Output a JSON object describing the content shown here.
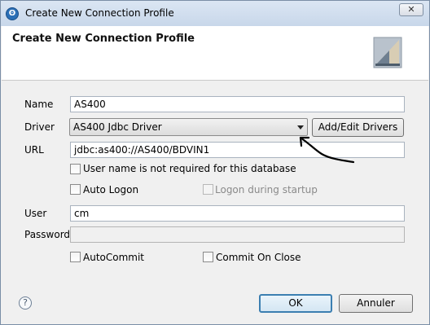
{
  "window": {
    "title": "Create New Connection Profile",
    "close_glyph": "✕"
  },
  "banner": {
    "title": "Create New Connection Profile"
  },
  "form": {
    "name_label": "Name",
    "name_value": "AS400",
    "driver_label": "Driver",
    "driver_value": "AS400 Jdbc Driver",
    "add_edit_drivers_label": "Add/Edit Drivers",
    "url_label": "URL",
    "url_value": "jdbc:as400://AS400/BDVIN1",
    "username_not_required_label": "User name is not required for this database",
    "auto_logon_label": "Auto Logon",
    "logon_during_startup_label": "Logon during startup",
    "user_label": "User",
    "user_value": "cm",
    "password_label": "Password",
    "password_value": "",
    "autocommit_label": "AutoCommit",
    "commit_on_close_label": "Commit On Close"
  },
  "footer": {
    "help_glyph": "?",
    "ok_label": "OK",
    "cancel_label": "Annuler"
  },
  "colors": {
    "default_button_border": "#3c7fb1",
    "annotation_ink": "#000000"
  }
}
